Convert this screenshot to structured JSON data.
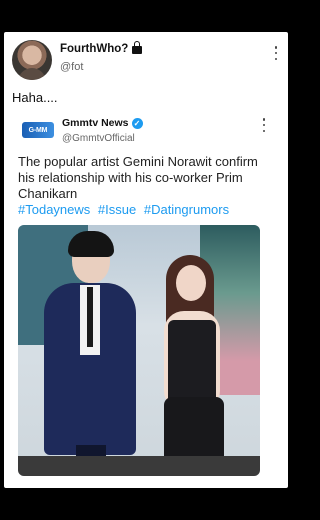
{
  "post": {
    "author_name": "FourthWho?",
    "author_handle": "@fot",
    "text": "Haha...."
  },
  "quoted": {
    "logo_text": "G-MM",
    "author_name": "Gmmtv News",
    "author_handle": "@GmmtvOfficial",
    "text": "The popular artist Gemini Norawit confirm his relationship with his co-worker Prim Chanikarn",
    "hashtags": [
      "#Todaynews",
      "#Issue",
      "#Datingrumors"
    ]
  },
  "icons": {
    "lock": "lock-icon",
    "verified": "verified-badge-icon",
    "more": "more-options-icon"
  },
  "colors": {
    "hashtag": "#1d9bf0",
    "verified": "#1d9bf0"
  }
}
